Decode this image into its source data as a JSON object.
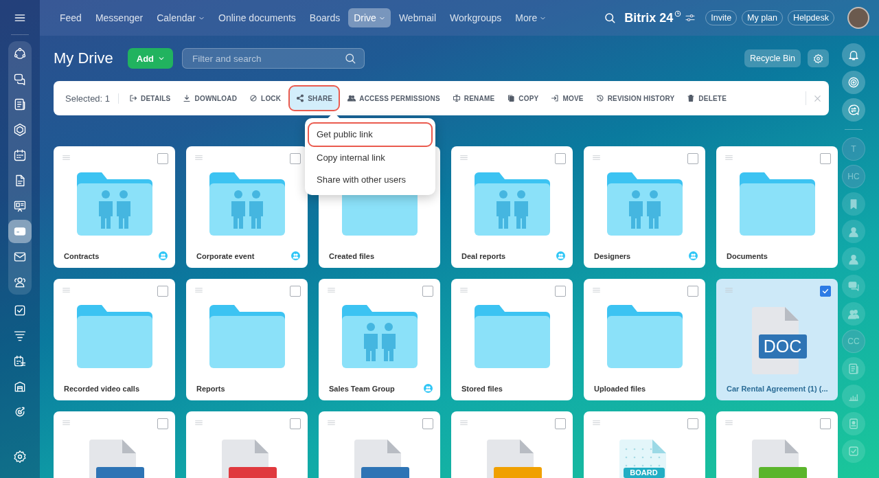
{
  "left_sidebar": {
    "groups": [
      [
        {
          "kind": "cycle",
          "selected": false
        },
        {
          "kind": "chats",
          "selected": false
        },
        {
          "kind": "news",
          "selected": false
        },
        {
          "kind": "hexagon",
          "selected": false
        },
        {
          "kind": "calendar",
          "selected": false
        },
        {
          "kind": "document",
          "selected": false
        },
        {
          "kind": "board",
          "selected": false
        },
        {
          "kind": "drive",
          "selected": true
        },
        {
          "kind": "mail",
          "selected": false
        },
        {
          "kind": "people",
          "selected": false
        }
      ],
      [
        {
          "kind": "task",
          "selected": false
        },
        {
          "kind": "funnel",
          "selected": false
        },
        {
          "kind": "schedule",
          "selected": false
        },
        {
          "kind": "store",
          "selected": false
        },
        {
          "kind": "target",
          "selected": false
        }
      ]
    ],
    "bottom": [
      {
        "kind": "settings",
        "selected": false
      }
    ]
  },
  "nav": {
    "items": [
      {
        "label": "Feed",
        "dropdown": false,
        "selected": false
      },
      {
        "label": "Messenger",
        "dropdown": false,
        "selected": false
      },
      {
        "label": "Calendar",
        "dropdown": true,
        "selected": false
      },
      {
        "label": "Online documents",
        "dropdown": false,
        "selected": false
      },
      {
        "label": "Boards",
        "dropdown": false,
        "selected": false
      },
      {
        "label": "Drive",
        "dropdown": true,
        "selected": true
      },
      {
        "label": "Webmail",
        "dropdown": false,
        "selected": false
      },
      {
        "label": "Workgroups",
        "dropdown": false,
        "selected": false
      },
      {
        "label": "More",
        "dropdown": true,
        "selected": false
      }
    ],
    "brand": "Bitrix 24",
    "buttons": [
      "Invite",
      "My plan",
      "Helpdesk"
    ]
  },
  "page": {
    "title": "My Drive",
    "add_button": "Add",
    "search": {
      "placeholder": "Filter and search"
    },
    "recycle_bin": "Recycle Bin"
  },
  "toolbar": {
    "selected_label": "Selected: 1",
    "actions": [
      {
        "label": "DETAILS",
        "kind": "details",
        "selected": false
      },
      {
        "label": "DOWNLOAD",
        "kind": "download",
        "selected": false
      },
      {
        "label": "LOCK",
        "kind": "lock",
        "selected": false
      },
      {
        "label": "SHARE",
        "kind": "share",
        "selected": true
      },
      {
        "label": "ACCESS PERMISSIONS",
        "kind": "permissions",
        "selected": false
      },
      {
        "label": "RENAME",
        "kind": "rename",
        "selected": false
      },
      {
        "label": "COPY",
        "kind": "copy",
        "selected": false
      },
      {
        "label": "MOVE",
        "kind": "move",
        "selected": false
      },
      {
        "label": "REVISION HISTORY",
        "kind": "history",
        "selected": false
      },
      {
        "label": "DELETE",
        "kind": "delete",
        "selected": false
      }
    ]
  },
  "share_menu": {
    "items": [
      {
        "label": "Get public link",
        "selected": true
      },
      {
        "label": "Copy internal link",
        "selected": false
      },
      {
        "label": "Share with other users",
        "selected": false
      }
    ]
  },
  "items": [
    {
      "name": "Contracts",
      "kind": "folder",
      "shared": true,
      "checked": false
    },
    {
      "name": "Corporate event",
      "kind": "folder",
      "shared": true,
      "checked": false
    },
    {
      "name": "Created files",
      "kind": "folder",
      "shared": false,
      "checked": false
    },
    {
      "name": "Deal reports",
      "kind": "folder",
      "shared": true,
      "checked": false
    },
    {
      "name": "Designers",
      "kind": "folder",
      "shared": true,
      "checked": false
    },
    {
      "name": "Documents",
      "kind": "folder",
      "shared": false,
      "checked": false
    },
    {
      "name": "Recorded video calls",
      "kind": "folder",
      "shared": false,
      "checked": false
    },
    {
      "name": "Reports",
      "kind": "folder",
      "shared": false,
      "checked": false
    },
    {
      "name": "Sales Team Group",
      "kind": "folder",
      "shared": true,
      "checked": false
    },
    {
      "name": "Stored files",
      "kind": "folder",
      "shared": false,
      "checked": false
    },
    {
      "name": "Uploaded files",
      "kind": "folder",
      "shared": false,
      "checked": false
    },
    {
      "name": "Car Rental Agreement (1) (...",
      "kind": "file",
      "format": "DOC",
      "color": "#2e74b5",
      "checked": true
    },
    {
      "kind": "file",
      "color": "#2e74b5",
      "checked": false
    },
    {
      "kind": "file",
      "color": "#e0393e",
      "checked": false
    },
    {
      "kind": "file",
      "color": "#2e74b5",
      "checked": false
    },
    {
      "kind": "file",
      "color": "#f0a000",
      "checked": false
    },
    {
      "kind": "board",
      "format": "BOARD",
      "color": "#22aec4",
      "checked": false
    },
    {
      "kind": "file",
      "color": "#5bb52c",
      "checked": false
    }
  ],
  "right_sidebar": [
    {
      "kind": "bell"
    },
    {
      "kind": "spiral"
    },
    {
      "kind": "chat"
    },
    {
      "kind": "divider"
    },
    {
      "kind": "initials",
      "text": "T"
    },
    {
      "kind": "initials",
      "text": "HC"
    },
    {
      "kind": "bookmark"
    },
    {
      "kind": "person"
    },
    {
      "kind": "person"
    },
    {
      "kind": "messages"
    },
    {
      "kind": "group"
    },
    {
      "kind": "initials",
      "text": "CC"
    },
    {
      "kind": "news"
    },
    {
      "kind": "chart"
    },
    {
      "kind": "contact"
    },
    {
      "kind": "task"
    }
  ]
}
